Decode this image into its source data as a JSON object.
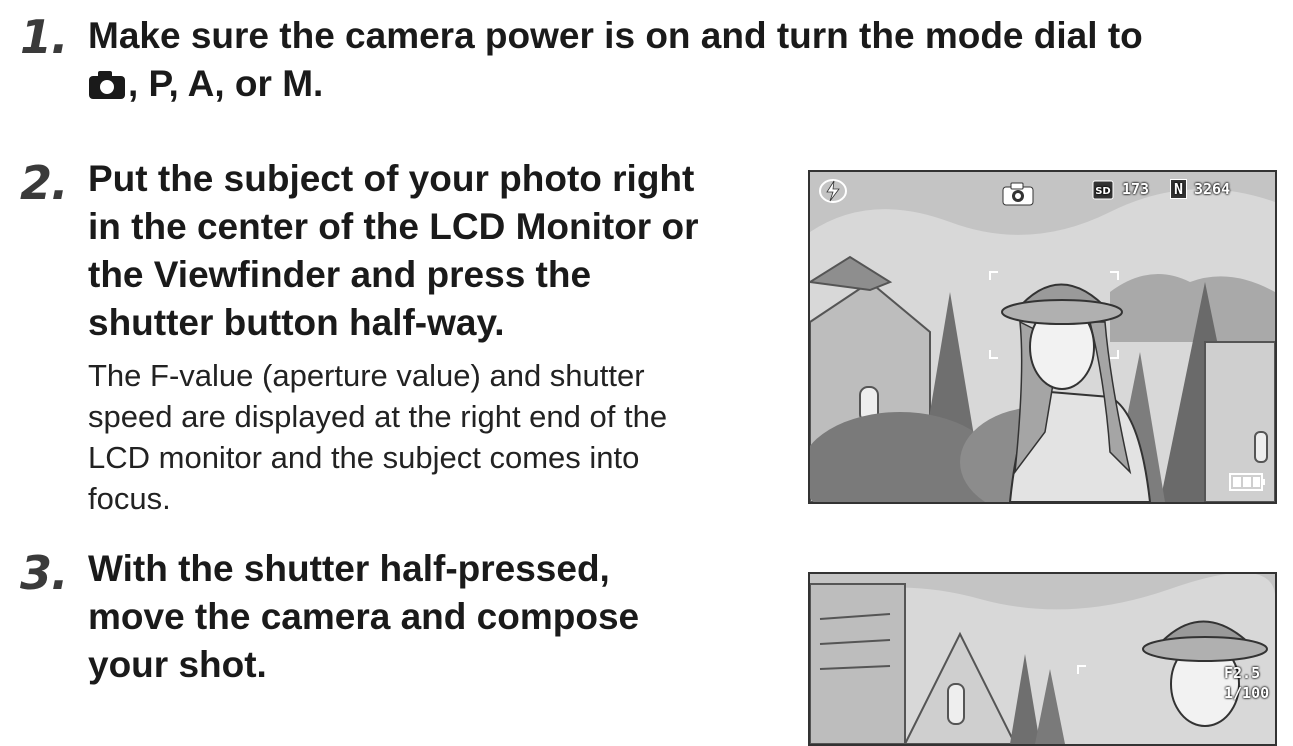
{
  "steps": [
    {
      "number": "1.",
      "heading_line1": "Make sure the camera power is on and turn the mode dial to",
      "heading_line2": ", P, A, or M.",
      "mode_icon": "camera-icon"
    },
    {
      "number": "2.",
      "heading_lines": [
        "Put the subject of your photo right",
        "in the center of the LCD Monitor or",
        "the Viewfinder and press the",
        "shutter button half-way."
      ],
      "body_lines": [
        "The F-value (aperture value) and shutter",
        "speed are displayed at the right end of the",
        "LCD monitor and the subject comes into",
        "focus."
      ]
    },
    {
      "number": "3.",
      "heading_lines": [
        "With the shutter half-pressed,",
        "move the camera and compose",
        "your shot."
      ]
    }
  ],
  "screen1": {
    "flash_icon": "flash-auto-icon",
    "mode_icon": "camera-icon",
    "sd_icon": "sd-card-icon",
    "count": "173",
    "quality_badge": "N",
    "remaining": "3264",
    "battery_icon": "battery-icon"
  },
  "screen2": {
    "aperture": "F2.5",
    "shutter": "1/100"
  }
}
